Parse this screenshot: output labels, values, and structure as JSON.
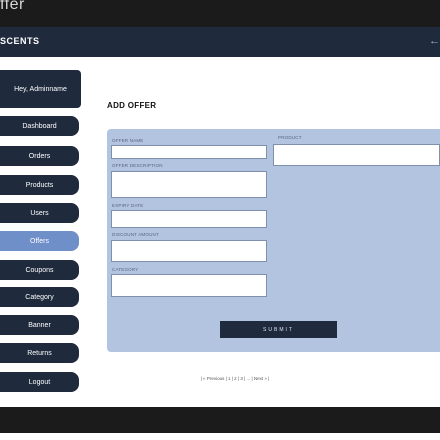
{
  "window": {
    "title": "ffer"
  },
  "header": {
    "brand": "SCENTS",
    "arrow": "←"
  },
  "sidebar": {
    "greeting": "Hey, Adminname",
    "items": [
      {
        "label": "Dashboard"
      },
      {
        "label": "Orders"
      },
      {
        "label": "Products"
      },
      {
        "label": "Users"
      },
      {
        "label": "Offers",
        "active": true
      },
      {
        "label": "Coupons"
      },
      {
        "label": "Category"
      },
      {
        "label": "Banner"
      },
      {
        "label": "Returns"
      },
      {
        "label": "Logout"
      }
    ]
  },
  "main": {
    "heading": "ADD OFFER",
    "form": {
      "offer_name_label": "OFFER NAME",
      "offer_name_value": "",
      "offer_description_label": "OFFER DESCRIPTION",
      "offer_description_value": "",
      "expiry_date_label": "EXPIRY DATE",
      "expiry_date_value": "",
      "discount_amount_label": "DISCOUNT AMOUNT",
      "discount_amount_value": "",
      "category_label": "CATEGORY",
      "category_value": "",
      "product_label": "PRODUCT",
      "product_value": "",
      "submit_label": "SUBMIT"
    },
    "pagination": "| « Previous | 1 | 2 | 3 | ... | Next » |"
  },
  "colors": {
    "navy": "#1f2a3d",
    "active_blue": "#6f8fc9",
    "panel_blue": "#b3c4e0",
    "dark_bar": "#1b1b1b"
  }
}
